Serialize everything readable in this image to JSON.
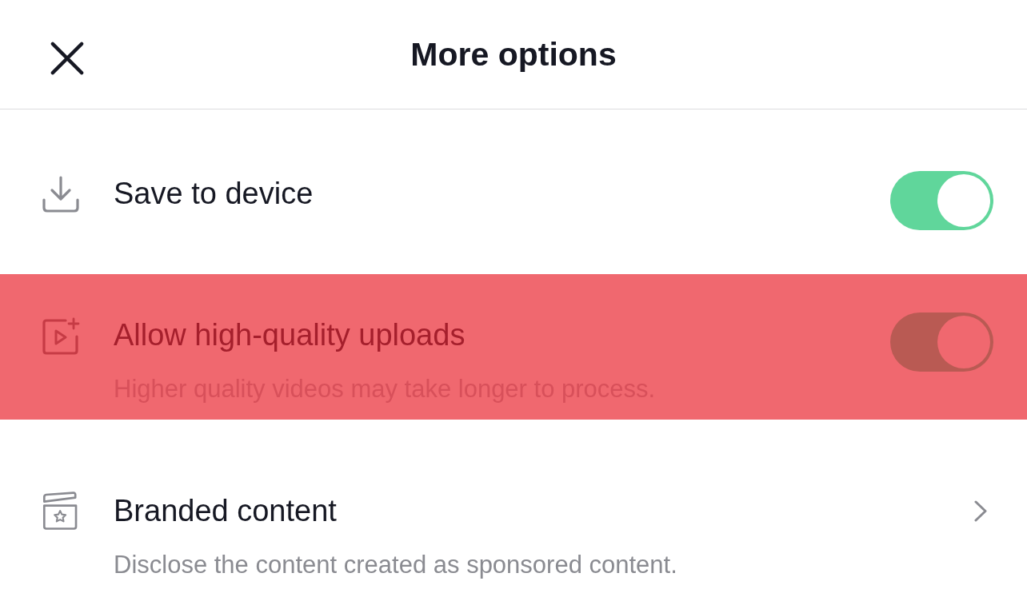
{
  "header": {
    "title": "More options"
  },
  "options": [
    {
      "kind": "toggle",
      "label": "Save to device",
      "on": true,
      "highlighted": false
    },
    {
      "kind": "toggle",
      "label": "Allow high-quality uploads",
      "description": "Higher quality videos may take longer to process.",
      "on": true,
      "highlighted": true
    },
    {
      "kind": "link",
      "label": "Branded content",
      "description": "Disclose the content created as sponsored content.",
      "highlighted": false
    }
  ]
}
